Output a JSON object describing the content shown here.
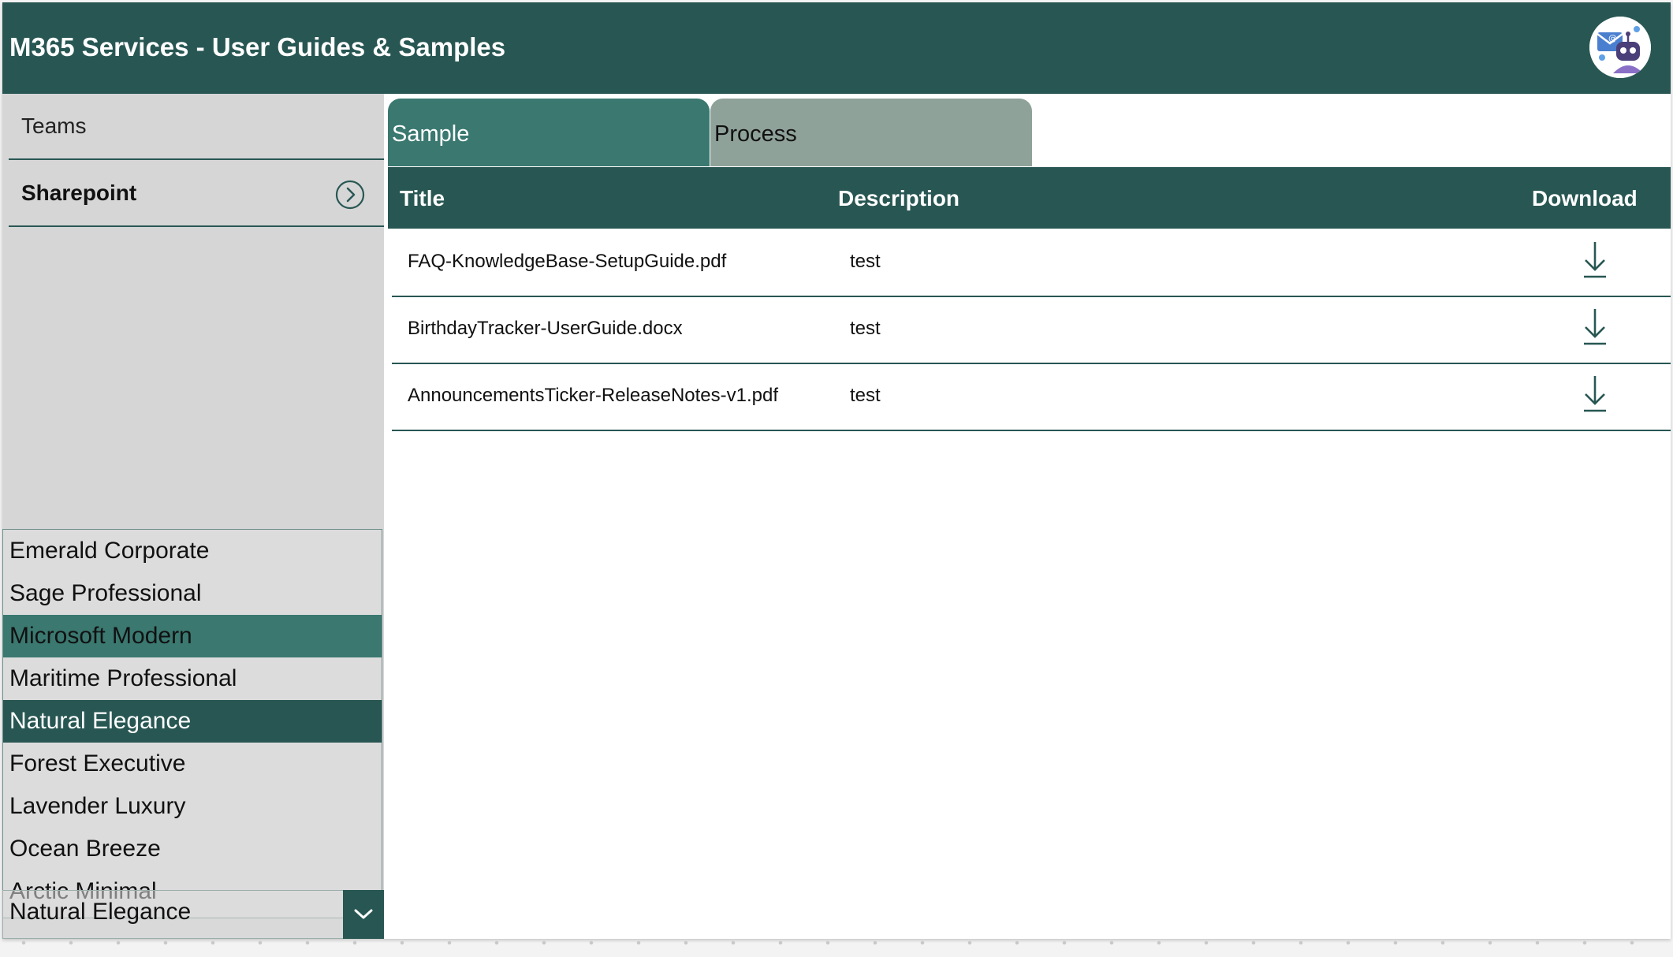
{
  "header": {
    "title": "M365 Services - User Guides & Samples",
    "avatar_icon": "robot-mail-avatar-icon"
  },
  "sidebar": {
    "items": [
      {
        "label": "Teams",
        "selected": false
      },
      {
        "label": "Sharepoint",
        "selected": true,
        "icon": "chevron-right-circle-icon"
      }
    ]
  },
  "themes": {
    "options": [
      "Emerald Corporate",
      "Sage Professional",
      "Microsoft Modern",
      "Maritime Professional",
      "Natural Elegance",
      "Forest Executive",
      "Lavender Luxury",
      "Ocean Breeze",
      "Arctic Minimal"
    ],
    "hovered": "Microsoft Modern",
    "selected": "Natural Elegance",
    "dropdown_value": "Natural Elegance",
    "dropdown_icon": "chevron-down-icon"
  },
  "tabs": [
    {
      "label": "Sample",
      "active": true
    },
    {
      "label": "Process",
      "active": false
    }
  ],
  "table": {
    "columns": {
      "title": "Title",
      "description": "Description",
      "download": "Download"
    },
    "rows": [
      {
        "title": "FAQ-KnowledgeBase-SetupGuide.pdf",
        "description": "test"
      },
      {
        "title": "BirthdayTracker-UserGuide.docx",
        "description": "test"
      },
      {
        "title": "AnnouncementsTicker-ReleaseNotes-v1.pdf",
        "description": "test"
      }
    ],
    "download_icon": "download-arrow-icon"
  },
  "colors": {
    "primary": "#285753",
    "accent": "#3a7870",
    "tab_inactive": "#8fa29a",
    "sidebar_bg": "#d6d6d6"
  }
}
